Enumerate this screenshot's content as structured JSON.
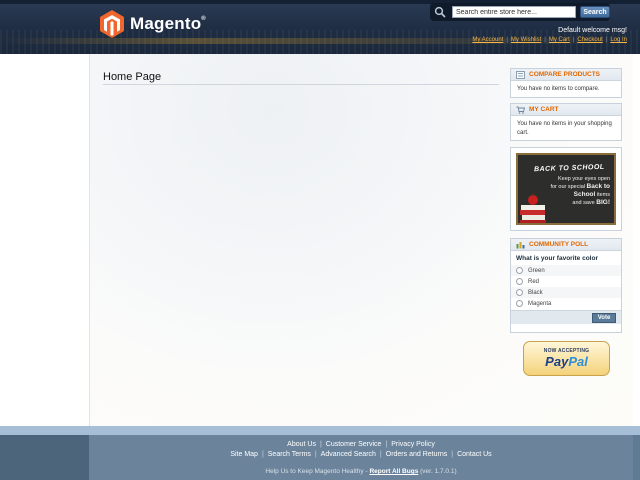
{
  "header": {
    "logo_text": "Magento",
    "logo_reg": "®",
    "search_placeholder": "Search entire store here...",
    "search_button": "Search",
    "welcome": "Default welcome msg!",
    "links": [
      "My Account",
      "My Wishlist",
      "My Cart",
      "Checkout",
      "Log In"
    ]
  },
  "main": {
    "page_title": "Home Page"
  },
  "sidebar": {
    "compare": {
      "title": "COMPARE PRODUCTS",
      "text": "You have no items to compare."
    },
    "cart": {
      "title": "MY CART",
      "text": "You have no items in your shopping cart."
    },
    "promo": {
      "title": "BACK TO SCHOOL",
      "line1": "Keep your eyes open",
      "line2": "for our special",
      "bold1": "Back to School",
      "line3": "items",
      "line4": "and save",
      "bold2": "BIG!"
    },
    "poll": {
      "title": "COMMUNITY POLL",
      "question": "What is your favorite color",
      "options": [
        "Green",
        "Red",
        "Black",
        "Magenta"
      ],
      "vote_button": "Vote"
    },
    "paypal": {
      "top": "NOW ACCEPTING",
      "brand_pay": "Pay",
      "brand_pal": "Pal"
    }
  },
  "footer": {
    "row1": [
      "About Us",
      "Customer Service",
      "Privacy Policy"
    ],
    "row2": [
      "Site Map",
      "Search Terms",
      "Advanced Search",
      "Orders and Returns",
      "Contact Us"
    ],
    "note_prefix": "Help Us to Keep Magento Healthy - ",
    "note_link": "Report All Bugs",
    "note_suffix": " (ver. 1.7.0.1)"
  },
  "colors": {
    "header_bg": "#1f2d43",
    "accent_orange": "#e26703",
    "link_gold": "#f3b548",
    "footer_bg": "#6b849b"
  }
}
